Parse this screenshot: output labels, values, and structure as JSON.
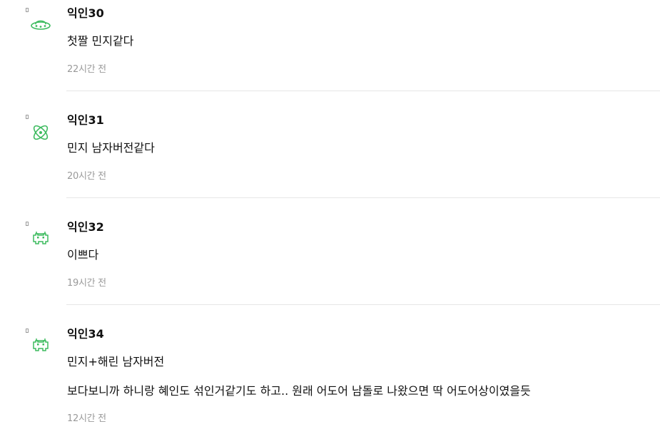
{
  "colors": {
    "avatar_green": "#3dbb5f",
    "time_gray": "#9a9a9a",
    "divider": "#e6e6e6"
  },
  "comments": [
    {
      "author": "익인30",
      "avatar_icon": "ufo-icon",
      "lines": [
        "첫짤 민지같다"
      ],
      "time": "22시간 전"
    },
    {
      "author": "익인31",
      "avatar_icon": "atom-icon",
      "lines": [
        "민지 남자버전같다"
      ],
      "time": "20시간 전"
    },
    {
      "author": "익인32",
      "avatar_icon": "space-invader-icon",
      "lines": [
        "이쁘다"
      ],
      "time": "19시간 전"
    },
    {
      "author": "익인34",
      "avatar_icon": "space-invader-icon",
      "lines": [
        "민지+해린 남자버전",
        "보다보니까 하니랑 혜인도 섞인거같기도 하고.. 원래 어도어 남돌로 나왔으면 딱 어도어상이였을듯"
      ],
      "time": "12시간 전"
    }
  ]
}
